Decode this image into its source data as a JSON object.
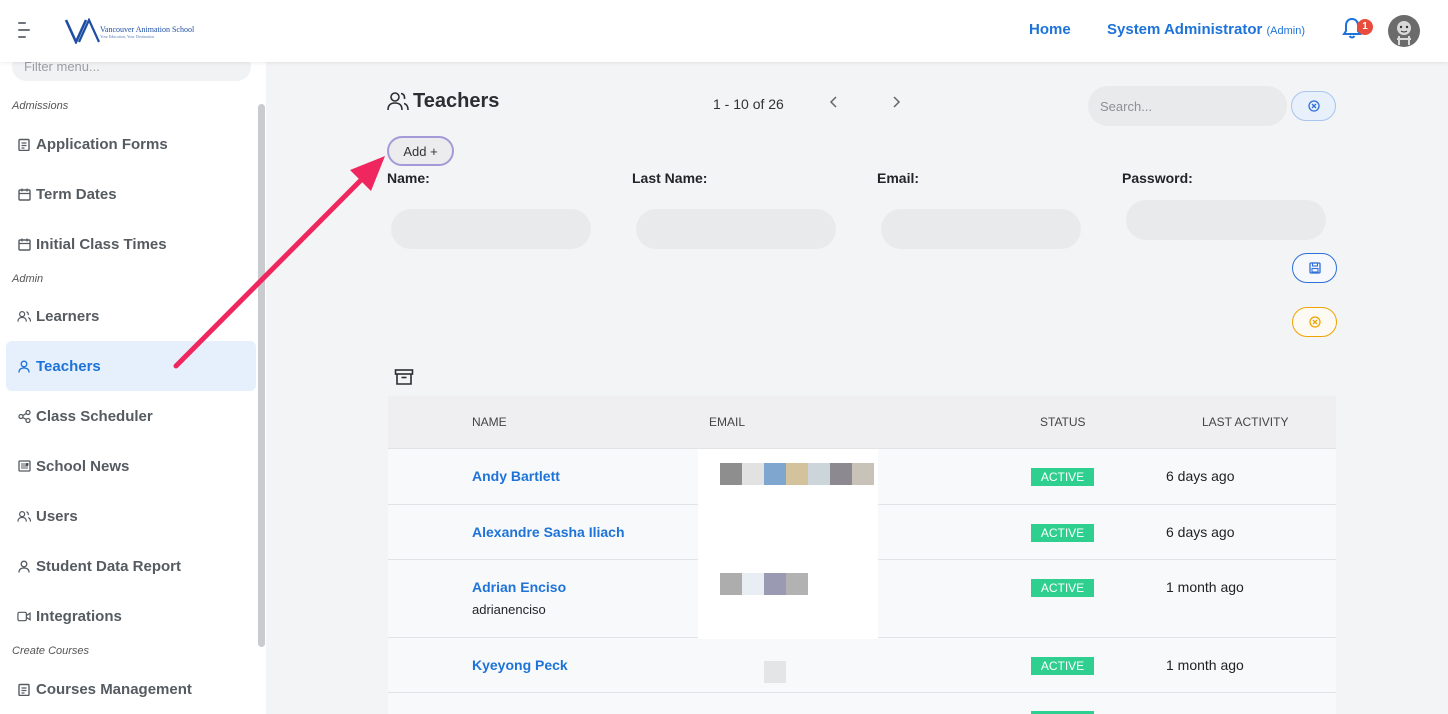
{
  "header": {
    "logo_text": "Vancouver Animation School",
    "logo_sub": "Your Education, Your Destination",
    "nav_home": "Home",
    "user_name": "System Administrator",
    "user_role": "(Admin)",
    "notification_count": "1"
  },
  "sidebar": {
    "filter_placeholder": "Filter menu...",
    "sections": {
      "admissions": "Admissions",
      "admin": "Admin",
      "create_courses": "Create Courses"
    },
    "items": [
      {
        "label": "Application Forms",
        "icon": "clipboard-icon"
      },
      {
        "label": "Term Dates",
        "icon": "calendar-icon"
      },
      {
        "label": "Initial Class Times",
        "icon": "calendar-icon"
      },
      {
        "label": "Learners",
        "icon": "users-icon"
      },
      {
        "label": "Teachers",
        "icon": "user-icon",
        "active": true
      },
      {
        "label": "Class Scheduler",
        "icon": "share-icon"
      },
      {
        "label": "School News",
        "icon": "newspaper-icon"
      },
      {
        "label": "Users",
        "icon": "users-icon"
      },
      {
        "label": "Student Data Report",
        "icon": "user-icon"
      },
      {
        "label": "Integrations",
        "icon": "video-icon"
      },
      {
        "label": "Courses Management",
        "icon": "clipboard-icon"
      }
    ]
  },
  "main": {
    "title": "Teachers",
    "pager_text": "1 - 10 of 26",
    "search_placeholder": "Search...",
    "add_label": "Add +",
    "form": {
      "name_label": "Name:",
      "last_name_label": "Last Name:",
      "email_label": "Email:",
      "password_label": "Password:"
    },
    "table": {
      "columns": [
        "NAME",
        "EMAIL",
        "STATUS",
        "LAST ACTIVITY"
      ],
      "rows": [
        {
          "name": "Andy Bartlett",
          "sub": "",
          "status": "ACTIVE",
          "last_activity": "6 days ago"
        },
        {
          "name": "Alexandre Sasha Iliach",
          "sub": "",
          "status": "ACTIVE",
          "last_activity": "6 days ago"
        },
        {
          "name": "Adrian Enciso",
          "sub": "adrianenciso",
          "status": "ACTIVE",
          "last_activity": "1 month ago"
        },
        {
          "name": "Kyeyong Peck",
          "sub": "",
          "status": "ACTIVE",
          "last_activity": "1 month ago"
        }
      ]
    }
  },
  "colors": {
    "accent": "#1e73d8",
    "active_badge": "#2fcf8f",
    "arrow": "#f0265e"
  }
}
